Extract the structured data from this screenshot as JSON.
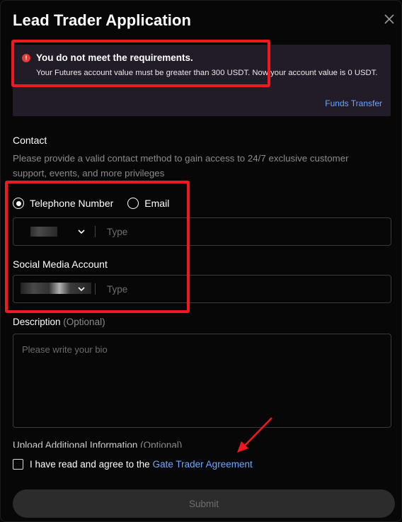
{
  "modal": {
    "title": "Lead Trader Application",
    "close_icon": "close-icon"
  },
  "alert": {
    "icon": "error-icon",
    "title": "You do not meet the requirements.",
    "body": "Your Futures account value must be greater than 300 USDT. Now your account value is 0 USDT.",
    "link": "Funds Transfer"
  },
  "contact": {
    "label": "Contact",
    "help": "Please provide a valid contact method to gain access to 24/7 exclusive customer support, events, and more privileges",
    "options": [
      {
        "label": "Telephone Number",
        "selected": true
      },
      {
        "label": "Email",
        "selected": false
      }
    ],
    "type_placeholder": "Type"
  },
  "social": {
    "label": "Social Media Account",
    "type_placeholder": "Type"
  },
  "description": {
    "label": "Description",
    "optional": "(Optional)",
    "placeholder": "Please write your bio"
  },
  "upload": {
    "label": "Upload Additional Information",
    "optional": "(Optional)"
  },
  "agreement": {
    "text": "I have read and agree to the",
    "link": "Gate Trader Agreement"
  },
  "submit": {
    "label": "Submit"
  },
  "colors": {
    "annotation_red": "#f0191f",
    "link_blue": "#6ea8ff",
    "alert_bg": "#221b28"
  }
}
